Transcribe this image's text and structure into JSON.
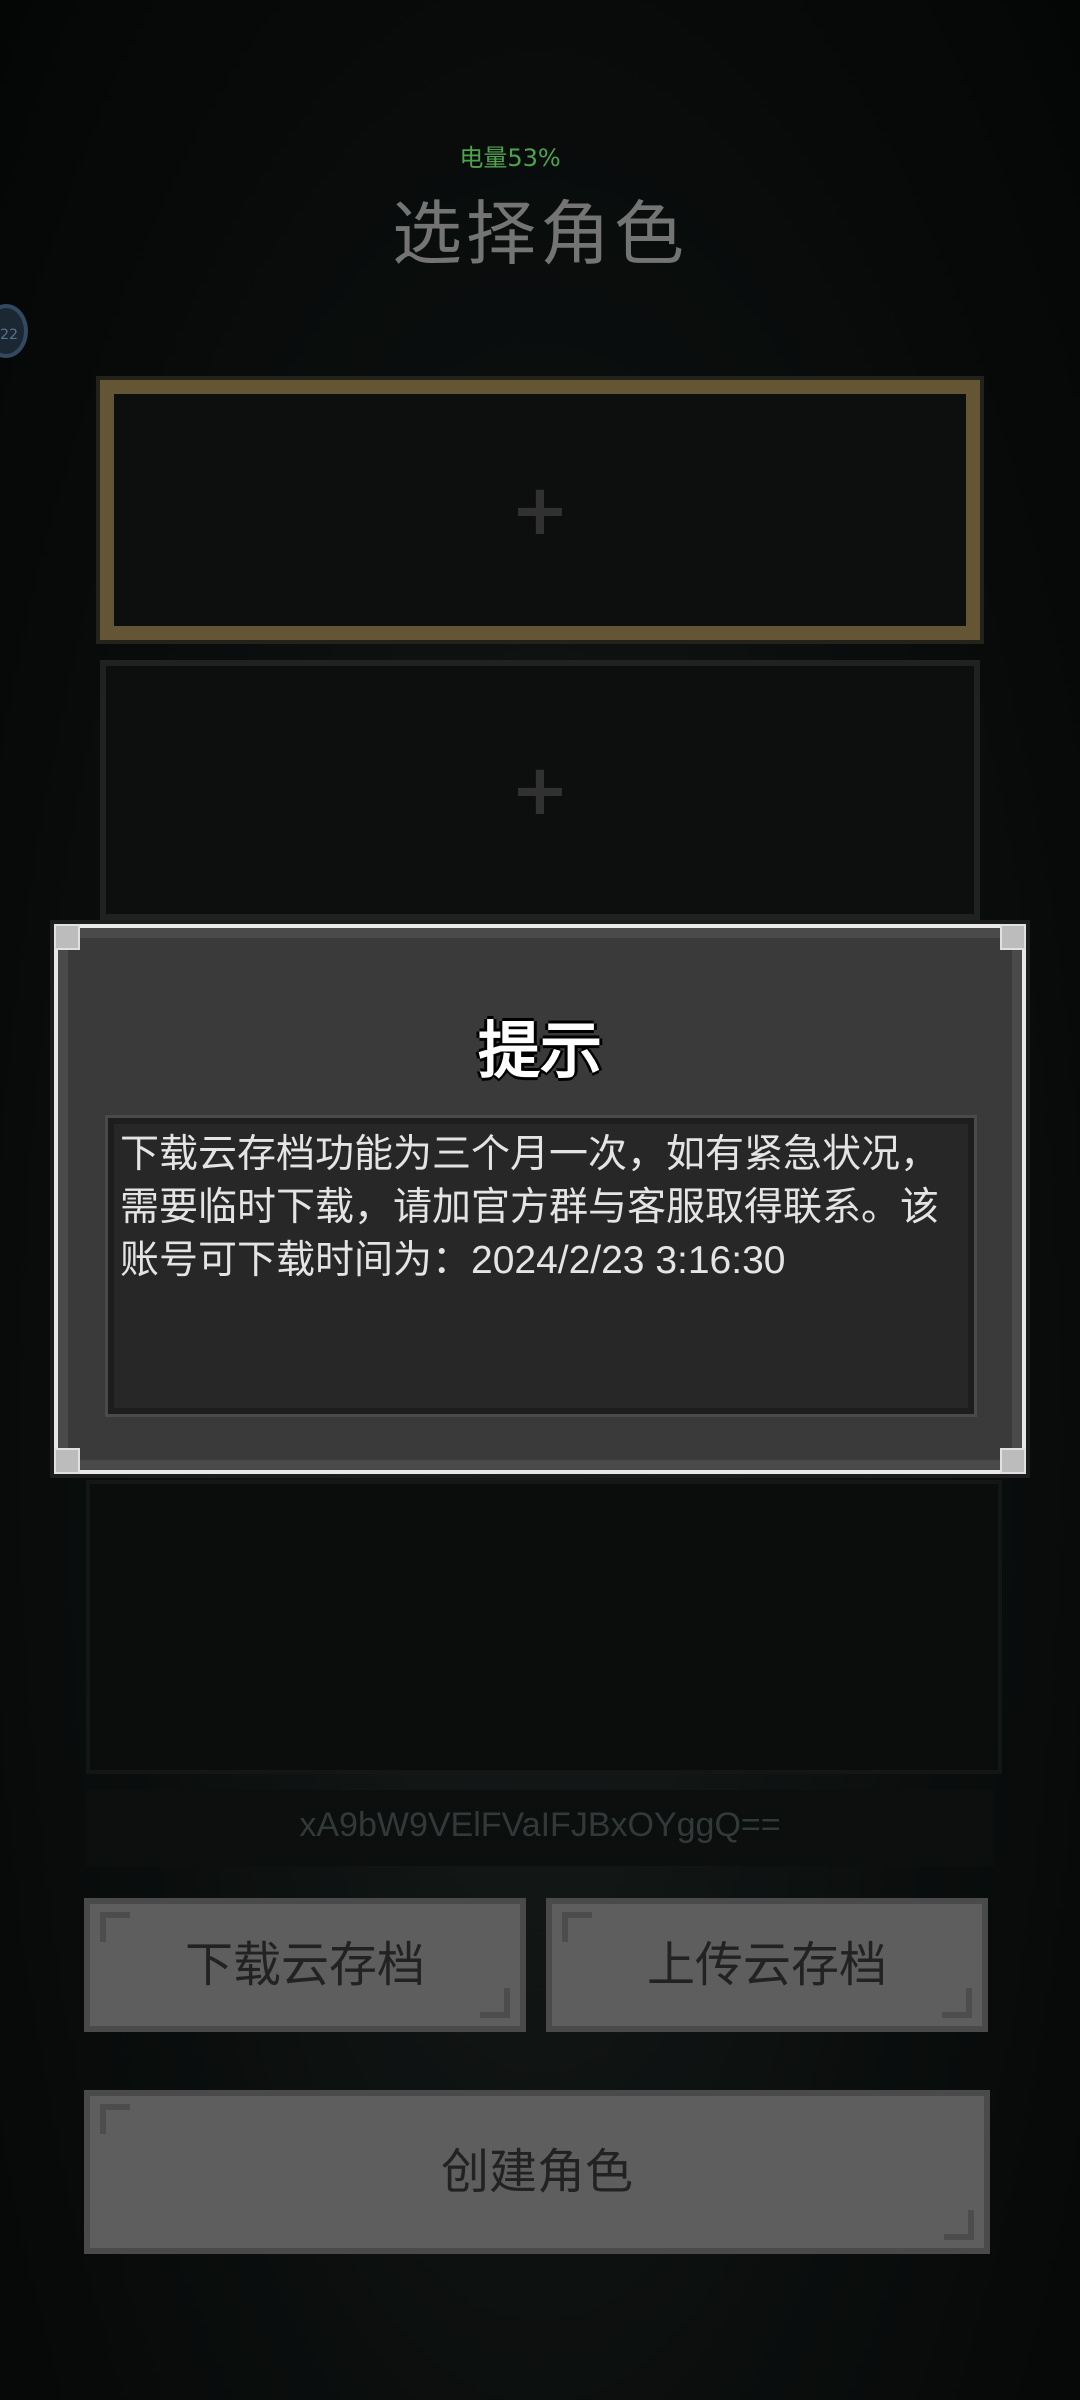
{
  "status": {
    "battery_label": "电量53%"
  },
  "header": {
    "title": "选择角色",
    "badge_text": "22"
  },
  "slots": [
    {
      "icon": "plus-icon",
      "symbol": "+"
    },
    {
      "icon": "plus-icon",
      "symbol": "+"
    }
  ],
  "account_code": "xA9bW9VElFVaIFJBxOYggQ==",
  "buttons": {
    "download": "下载云存档",
    "upload": "上传云存档",
    "create": "创建角色"
  },
  "dialog": {
    "title": "提示",
    "message": "下载云存档功能为三个月一次，如有紧急状况，需要临时下载，请加官方群与客服取得联系。该账号可下载时间为：2024/2/23 3:16:30"
  },
  "colors": {
    "battery_text": "#5fc75f",
    "selected_slot_border": "#7a6a40",
    "dialog_bg": "#3a3a3a",
    "button_bg": "#737373"
  }
}
